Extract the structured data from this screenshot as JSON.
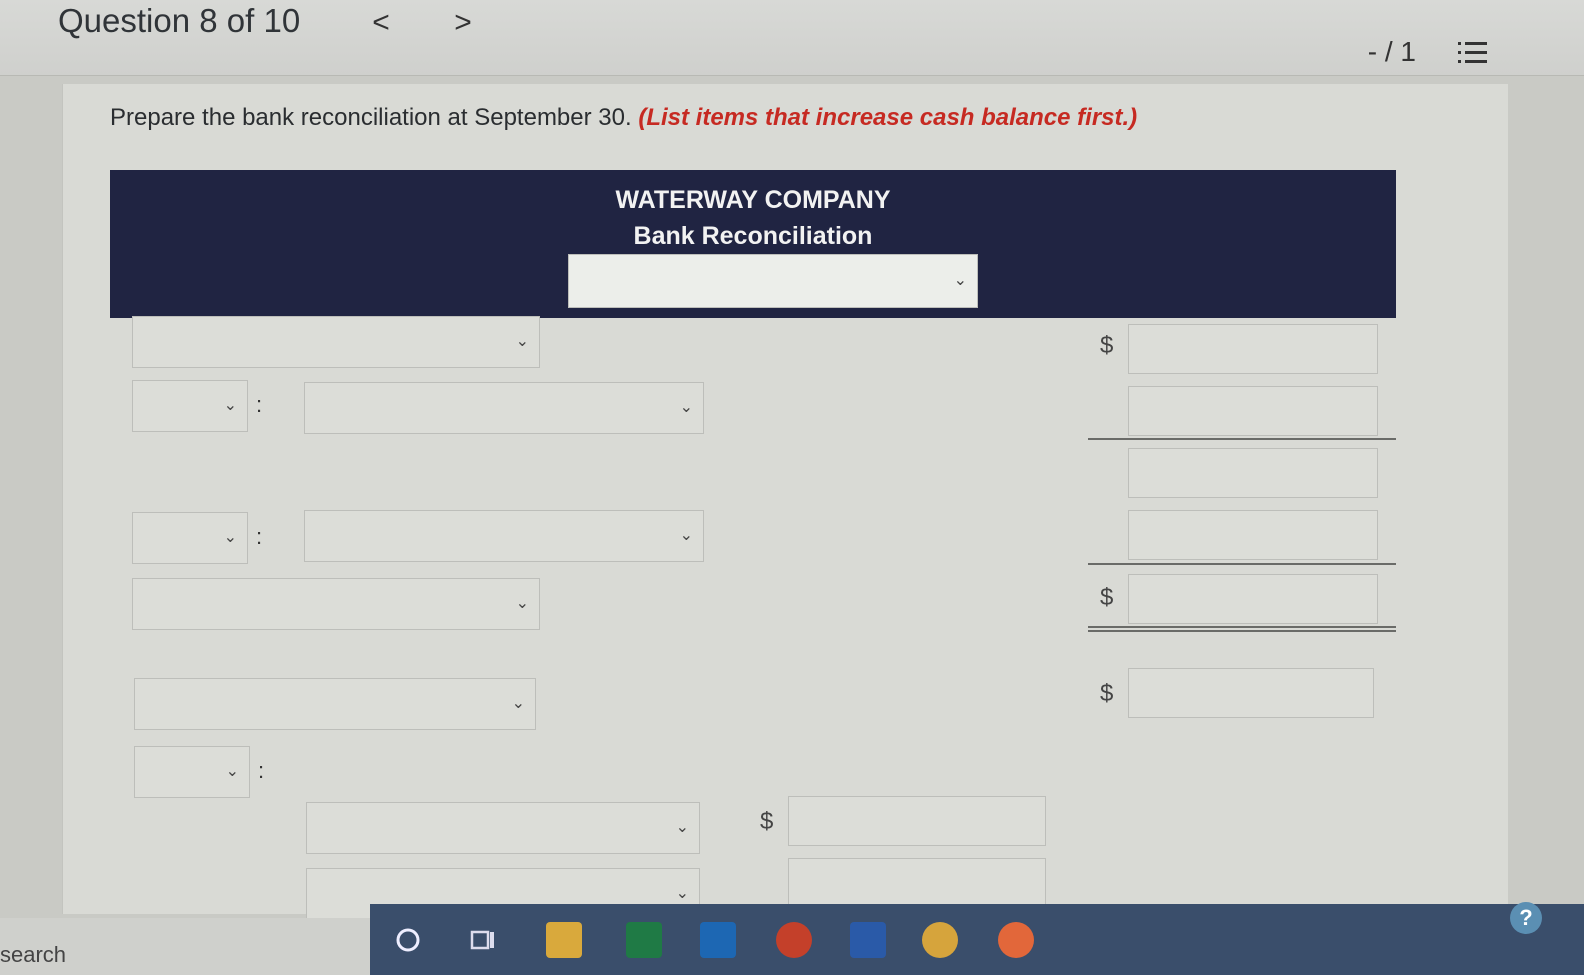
{
  "header": {
    "question_label": "Question 8 of 10",
    "prev_glyph": "<",
    "next_glyph": ">",
    "pager": "- / 1"
  },
  "instructions": {
    "main": "Prepare the bank reconciliation at September 30.",
    "note": "(List items that increase cash balance first.)"
  },
  "report": {
    "company": "WATERWAY COMPANY",
    "title": "Bank Reconciliation"
  },
  "form": {
    "dollar_sign": "$",
    "colon": ":",
    "chevron": "⌄"
  },
  "taskbar": {
    "search_label": "search"
  },
  "colors": {
    "header_band": "#202442",
    "note_red": "#c62a22",
    "taskbar": "#3a4e6b"
  }
}
